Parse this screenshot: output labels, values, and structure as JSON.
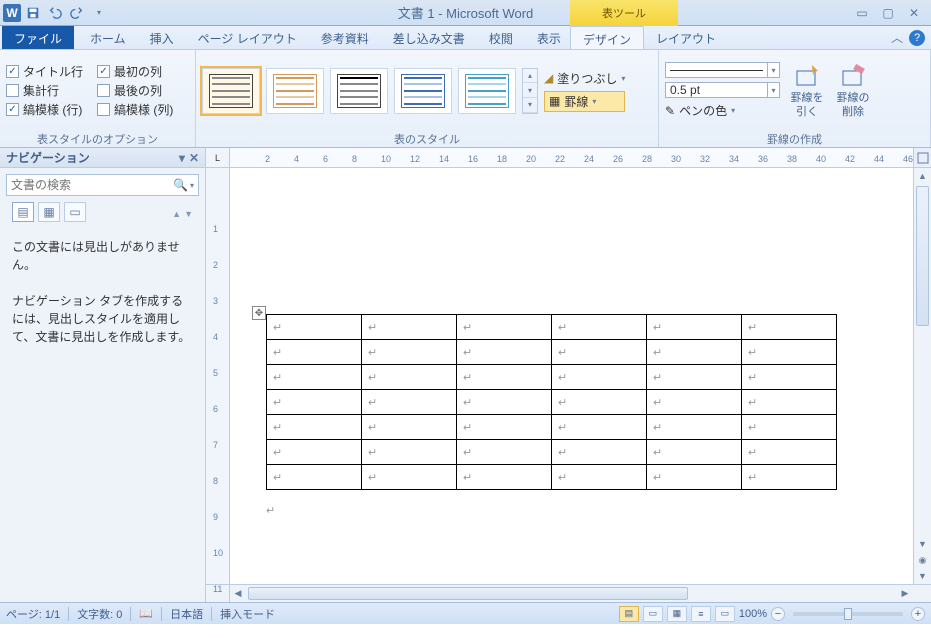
{
  "title": "文書 1 - Microsoft Word",
  "context_tool": "表ツール",
  "tabs": {
    "file": "ファイル",
    "home": "ホーム",
    "insert": "挿入",
    "pagelayout": "ページ レイアウト",
    "references": "参考資料",
    "mailings": "差し込み文書",
    "review": "校閲",
    "view": "表示",
    "design": "デザイン",
    "layout": "レイアウト"
  },
  "ribbon": {
    "options_group": "表スタイルのオプション",
    "styles_group": "表のスタイル",
    "borders_group": "罫線の作成",
    "chk_title_row": "タイトル行",
    "chk_first_col": "最初の列",
    "chk_total_row": "集計行",
    "chk_last_col": "最後の列",
    "chk_banded_rows": "縞模様 (行)",
    "chk_banded_cols": "縞模様 (列)",
    "shading": "塗りつぶし",
    "borders": "罫線",
    "pen_weight": "0.5 pt",
    "pen_color": "ペンの色",
    "draw_table": "罫線を引く",
    "eraser": "罫線の削除"
  },
  "nav": {
    "title": "ナビゲーション",
    "search_placeholder": "文書の検索",
    "msg1": "この文書には見出しがありません。",
    "msg2": "ナビゲーション タブを作成するには、見出しスタイルを適用して、文書に見出しを作成します。"
  },
  "status": {
    "page": "ページ: 1/1",
    "words": "文字数: 0",
    "lang": "日本語",
    "mode": "挿入モード",
    "zoom": "100%"
  },
  "cell_marker": "↵"
}
